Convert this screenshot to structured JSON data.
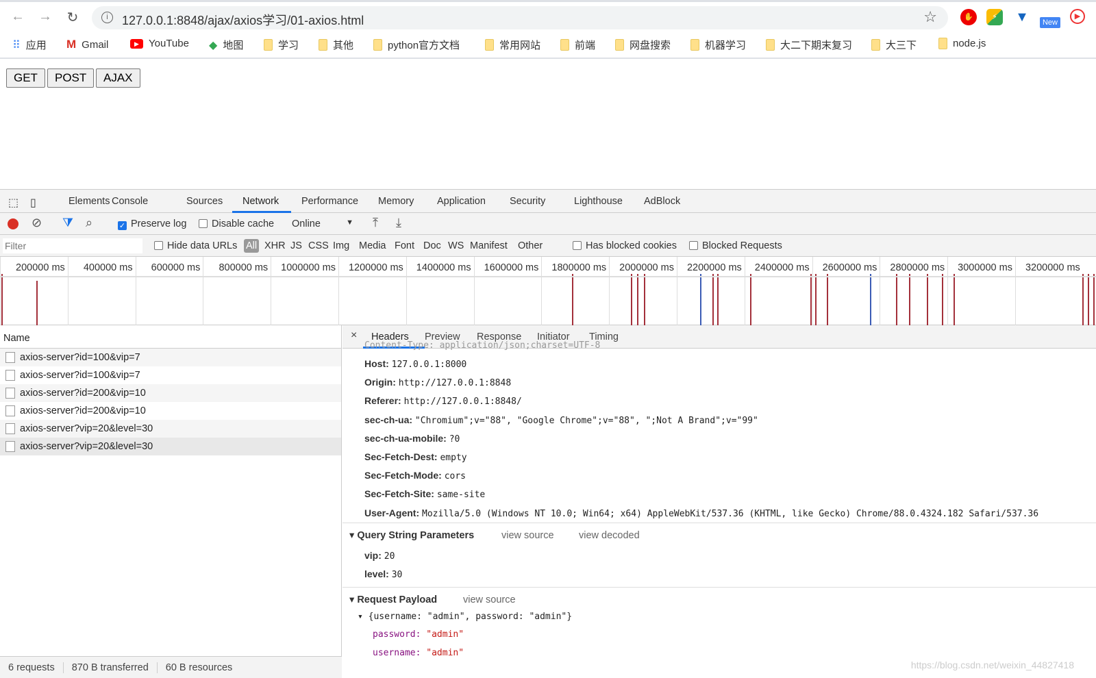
{
  "browser": {
    "url": "127.0.0.1:8848/ajax/axios学习/01-axios.html",
    "back_icon": "←",
    "forward_icon": "→",
    "reload_icon": "↻",
    "bookmarks": [
      "应用",
      "Gmail",
      "YouTube",
      "地图",
      "学习",
      "其他",
      "python官方文档",
      "常用网站",
      "前端",
      "网盘搜索",
      "机器学习",
      "大二下期末复习",
      "大三下",
      "node.js"
    ],
    "extension_new_label": "New"
  },
  "page": {
    "buttons": [
      "GET",
      "POST",
      "AJAX"
    ]
  },
  "devtools": {
    "tabs": [
      "Elements",
      "Console",
      "Sources",
      "Network",
      "Performance",
      "Memory",
      "Application",
      "Security",
      "Lighthouse",
      "AdBlock"
    ],
    "active_tab": "Network",
    "toolbar": {
      "preserve_log": "Preserve log",
      "preserve_log_checked": true,
      "disable_cache": "Disable cache",
      "throttle": "Online"
    },
    "filter": {
      "placeholder": "Filter",
      "hide_data_urls": "Hide data URLs",
      "types": [
        "All",
        "XHR",
        "JS",
        "CSS",
        "Img",
        "Media",
        "Font",
        "Doc",
        "WS",
        "Manifest",
        "Other"
      ],
      "has_blocked_cookies": "Has blocked cookies",
      "blocked_requests": "Blocked Requests"
    },
    "timeline_ticks": [
      "200000 ms",
      "400000 ms",
      "600000 ms",
      "800000 ms",
      "1000000 ms",
      "1200000 ms",
      "1400000 ms",
      "1600000 ms",
      "1800000 ms",
      "2000000 ms",
      "2200000 ms",
      "2400000 ms",
      "2600000 ms",
      "2800000 ms",
      "3000000 ms",
      "3200000 ms"
    ],
    "name_header": "Name",
    "requests": [
      "axios-server?id=100&vip=7",
      "axios-server?id=100&vip=7",
      "axios-server?id=200&vip=10",
      "axios-server?id=200&vip=10",
      "axios-server?vip=20&level=30",
      "axios-server?vip=20&level=30"
    ],
    "status": [
      "6 requests",
      "870 B transferred",
      "60 B resources"
    ],
    "detail_tabs": [
      "Headers",
      "Preview",
      "Response",
      "Initiator",
      "Timing"
    ],
    "headers": [
      {
        "k": "Host:",
        "v": "127.0.0.1:8000"
      },
      {
        "k": "Origin:",
        "v": "http://127.0.0.1:8848"
      },
      {
        "k": "Referer:",
        "v": "http://127.0.0.1:8848/"
      },
      {
        "k": "sec-ch-ua:",
        "v": "\"Chromium\";v=\"88\", \"Google Chrome\";v=\"88\", \";Not A Brand\";v=\"99\""
      },
      {
        "k": "sec-ch-ua-mobile:",
        "v": "?0"
      },
      {
        "k": "Sec-Fetch-Dest:",
        "v": "empty"
      },
      {
        "k": "Sec-Fetch-Mode:",
        "v": "cors"
      },
      {
        "k": "Sec-Fetch-Site:",
        "v": "same-site"
      },
      {
        "k": "User-Agent:",
        "v": "Mozilla/5.0 (Windows NT 10.0; Win64; x64) AppleWebKit/537.36 (KHTML, like Gecko) Chrome/88.0.4324.182 Safari/537.36"
      }
    ],
    "query": {
      "title": "Query String Parameters",
      "view_source": "view source",
      "view_decoded": "view decoded",
      "params": [
        {
          "k": "vip:",
          "v": "20"
        },
        {
          "k": "level:",
          "v": "30"
        }
      ]
    },
    "payload": {
      "title": "Request Payload",
      "view_source": "view source",
      "summary": "{username: \"admin\", password: \"admin\"}",
      "fields": [
        {
          "k": "password:",
          "v": "\"admin\""
        },
        {
          "k": "username:",
          "v": "\"admin\""
        }
      ]
    }
  },
  "watermark": "https://blog.csdn.net/weixin_44827418"
}
